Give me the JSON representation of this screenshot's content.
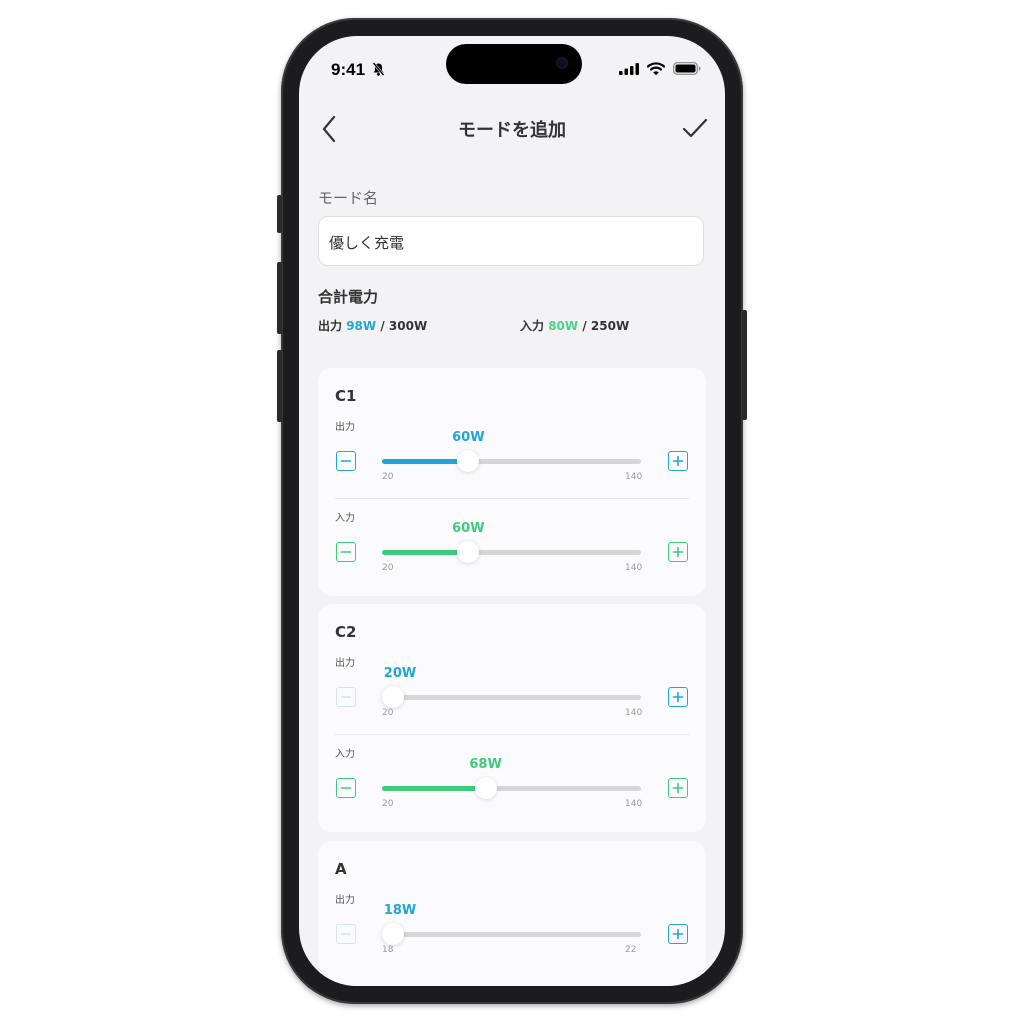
{
  "colors": {
    "output": "#1ea7d8",
    "input": "#3ecb7c",
    "disabled": "#cfe7ee",
    "track": "#d6d6d8"
  },
  "status": {
    "time": "9:41",
    "icons": [
      "bell-slash-icon",
      "signal-icon",
      "wifi-icon",
      "battery-icon"
    ]
  },
  "nav": {
    "title": "モードを追加",
    "back_icon": "chevron-left-icon",
    "confirm_icon": "checkmark-icon"
  },
  "mode_name": {
    "label": "モード名",
    "value": "優しく充電"
  },
  "total": {
    "label": "合計電力",
    "output": {
      "label": "出力",
      "value": "98W",
      "max": "/ 300W"
    },
    "input": {
      "label": "入力",
      "value": "80W",
      "max": "/ 250W"
    }
  },
  "ports": [
    {
      "name": "C1",
      "rows": [
        {
          "label": "出力",
          "kind": "output",
          "value": 60,
          "display": "60W",
          "min": 20,
          "max": 140,
          "min_label": "20",
          "max_label": "140",
          "minus_enabled": true
        },
        {
          "label": "入力",
          "kind": "input",
          "value": 60,
          "display": "60W",
          "min": 20,
          "max": 140,
          "min_label": "20",
          "max_label": "140",
          "minus_enabled": true
        }
      ]
    },
    {
      "name": "C2",
      "rows": [
        {
          "label": "出力",
          "kind": "output",
          "value": 20,
          "display": "20W",
          "min": 20,
          "max": 140,
          "min_label": "20",
          "max_label": "140",
          "minus_enabled": false
        },
        {
          "label": "入力",
          "kind": "input",
          "value": 68,
          "display": "68W",
          "min": 20,
          "max": 140,
          "min_label": "20",
          "max_label": "140",
          "minus_enabled": true
        }
      ]
    },
    {
      "name": "A",
      "rows": [
        {
          "label": "出力",
          "kind": "output",
          "value": 18,
          "display": "18W",
          "min": 18,
          "max": 22,
          "min_label": "18",
          "max_label": "22",
          "minus_enabled": false
        }
      ]
    }
  ]
}
